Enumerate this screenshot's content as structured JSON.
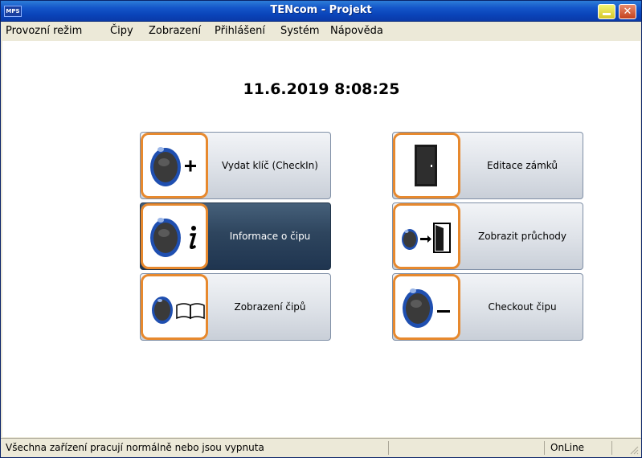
{
  "window": {
    "title": "TENcom - Projekt",
    "icon_text": "MPS"
  },
  "menu": {
    "items": [
      "Provozní režim",
      "Čipy",
      "Zobrazení",
      "Přihlášení",
      "Systém",
      "Nápověda"
    ]
  },
  "main": {
    "datetime": "11.6.2019 8:08:25",
    "tiles": [
      {
        "label": "Vydat klíč (CheckIn)",
        "icon": "chip-plus-icon",
        "active": false
      },
      {
        "label": "Editace zámků",
        "icon": "door-icon",
        "active": false
      },
      {
        "label": "Informace o čipu",
        "icon": "chip-info-icon",
        "active": true
      },
      {
        "label": "Zobrazit průchody",
        "icon": "chip-door-passage-icon",
        "active": false
      },
      {
        "label": "Zobrazení čipů",
        "icon": "chip-book-icon",
        "active": false
      },
      {
        "label": "Checkout čipu",
        "icon": "chip-minus-icon",
        "active": false
      }
    ]
  },
  "statusbar": {
    "message": "Všechna zařízení pracují normálně nebo jsou vypnuta",
    "connection": "OnLine"
  },
  "colors": {
    "titlebar": "#0a44b9",
    "tile_border_accent": "#e7892e",
    "chip_blue": "#1f4fb0",
    "active_tile": "#2e455e"
  }
}
